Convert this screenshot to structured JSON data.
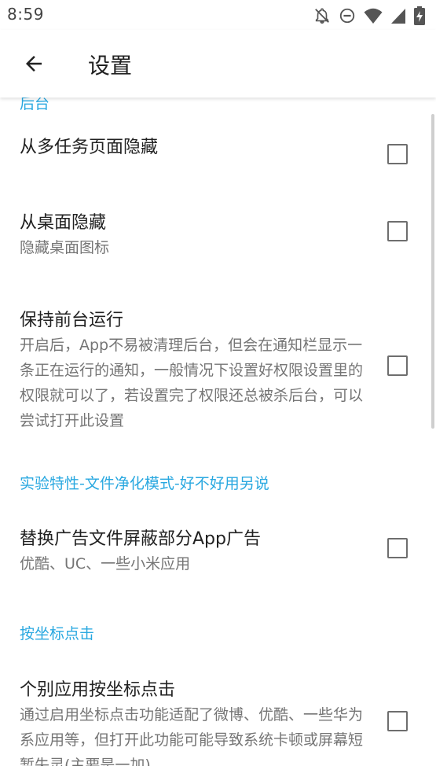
{
  "status_bar": {
    "time": "8:59"
  },
  "app_bar": {
    "title": "设置"
  },
  "sections": {
    "background": {
      "header": "后台"
    },
    "experimental": {
      "header": "实验特性-文件净化模式-好不好用另说"
    },
    "coord_click": {
      "header": "按坐标点击"
    }
  },
  "prefs": {
    "hide_recents": {
      "title": "从多任务页面隐藏",
      "checked": false
    },
    "hide_launcher": {
      "title": "从桌面隐藏",
      "summary": "隐藏桌面图标",
      "checked": false
    },
    "foreground": {
      "title": "保持前台运行",
      "summary": "开启后，App不易被清理后台，但会在通知栏显示一条正在运行的通知，一般情况下设置好权限设置里的权限就可以了，若设置完了权限还总被杀后台，可以尝试打开此设置",
      "checked": false
    },
    "replace_ad_files": {
      "title": "替换广告文件屏蔽部分App广告",
      "summary": "优酷、UC、一些小米应用",
      "checked": false
    },
    "coord_click": {
      "title": "个别应用按坐标点击",
      "summary": "通过启用坐标点击功能适配了微博、优酷、一些华为系应用等，但打开此功能可能导致系统卡顿或屏幕短暂失灵(主要是一加)。",
      "checked": false
    }
  },
  "colors": {
    "accent": "#29a8e0",
    "text_primary": "#212121",
    "text_secondary": "#757575",
    "checkbox_border": "#6e6e6e"
  },
  "icons": {
    "status": [
      "notifications-off-icon",
      "do-not-disturb-icon",
      "wifi-icon",
      "cell-signal-icon",
      "battery-charging-icon"
    ],
    "back": "arrow-back-icon"
  }
}
